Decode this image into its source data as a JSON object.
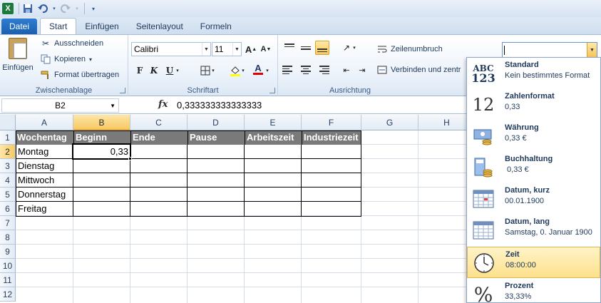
{
  "qat": {
    "app_icon": "X"
  },
  "tabs": [
    {
      "label": "Datei",
      "active": false,
      "file": true
    },
    {
      "label": "Start",
      "active": true
    },
    {
      "label": "Einfügen",
      "active": false
    },
    {
      "label": "Seitenlayout",
      "active": false
    },
    {
      "label": "Formeln",
      "active": false
    }
  ],
  "clipboard": {
    "paste_label": "Einfügen",
    "cut_label": "Ausschneiden",
    "copy_label": "Kopieren",
    "copy_arrow": "▾",
    "format_painter_label": "Format übertragen",
    "group_label": "Zwischenablage"
  },
  "font": {
    "family": "Calibri",
    "size": "11",
    "bold": "F",
    "italic": "K",
    "underline": "U",
    "group_label": "Schriftart"
  },
  "alignment": {
    "wrap_label": "Zeilenumbruch",
    "merge_label": "Verbinden und zentr",
    "group_label": "Ausrichtung"
  },
  "formula_bar": {
    "name_box": "B2",
    "fx": "fx",
    "value": "0,333333333333333"
  },
  "grid": {
    "columns": [
      "A",
      "B",
      "C",
      "D",
      "E",
      "F",
      "G",
      "H"
    ],
    "rows": [
      "1",
      "2",
      "3",
      "4",
      "5",
      "6",
      "7",
      "8",
      "9",
      "10",
      "11",
      "12"
    ],
    "header_row": [
      "Wochentag",
      "Beginn",
      "Ende",
      "Pause",
      "Arbeitszeit",
      "Industriezeit"
    ],
    "days": [
      "Montag",
      "Dienstag",
      "Mittwoch",
      "Donnerstag",
      "Freitag"
    ],
    "b2_value": "0,33",
    "selected_cell": "B2"
  },
  "number_formats": [
    {
      "title": "Standard",
      "sample": "Kein bestimmtes Format",
      "icon": "abc-123-icon"
    },
    {
      "title": "Zahlenformat",
      "sample": "0,33",
      "icon": "number-12-icon"
    },
    {
      "title": "Währung",
      "sample": "0,33 €",
      "icon": "currency-icon"
    },
    {
      "title": "Buchhaltung",
      "sample": " 0,33 €",
      "icon": "accounting-icon"
    },
    {
      "title": "Datum, kurz",
      "sample": "00.01.1900",
      "icon": "calendar-short-icon"
    },
    {
      "title": "Datum, lang",
      "sample": "Samstag, 0. Januar 1900",
      "icon": "calendar-long-icon"
    },
    {
      "title": "Zeit",
      "sample": "08:00:00",
      "icon": "clock-icon",
      "highlighted": true
    },
    {
      "title": "Prozent",
      "sample": "33,33%",
      "icon": "percent-icon"
    }
  ],
  "icon_glyphs": {
    "abc": "ABC",
    "n123": "123",
    "n12": "12",
    "percent": "%"
  }
}
